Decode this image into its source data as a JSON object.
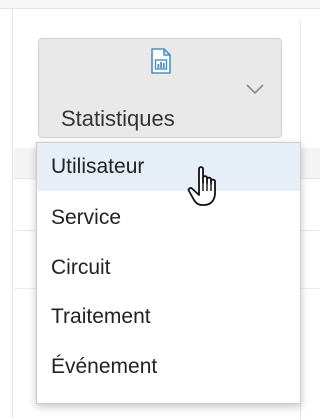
{
  "toolbar": {
    "stats_button": {
      "label": "Statistiques",
      "icon": "report-chart-icon",
      "caret": "chevron-down-icon"
    }
  },
  "menu": {
    "items": [
      {
        "label": "Utilisateur",
        "highlighted": true
      },
      {
        "label": "Service",
        "highlighted": false
      },
      {
        "label": "Circuit",
        "highlighted": false
      },
      {
        "label": "Traitement",
        "highlighted": false
      },
      {
        "label": "Événement",
        "highlighted": false
      }
    ]
  },
  "pointer": {
    "icon": "hand-pointer-icon"
  },
  "colors": {
    "accent": "#4a90c8",
    "button_bg": "#e9e9e9",
    "highlight_bg": "#e6eef7",
    "text": "#222222"
  }
}
